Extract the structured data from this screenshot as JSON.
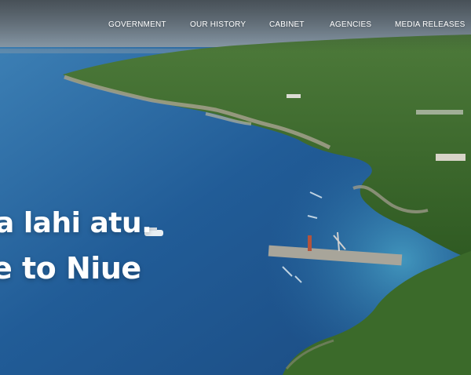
{
  "nav": {
    "items": [
      {
        "label": "GOVERNMENT"
      },
      {
        "label": "OUR HISTORY"
      },
      {
        "label": "CABINET"
      },
      {
        "label": "AGENCIES"
      },
      {
        "label": "MEDIA RELEASES"
      }
    ]
  },
  "hero": {
    "headline_line1": "a lahi atu.",
    "headline_line2": "e to Niue"
  },
  "colors": {
    "ocean_deep": "#1a4f86",
    "ocean_light": "#2f7fb8",
    "reef": "#3f9ec4",
    "vegetation": "#3f6f2c",
    "cliff": "#9a9a8a",
    "sky_haze": "#8fa3b5"
  }
}
